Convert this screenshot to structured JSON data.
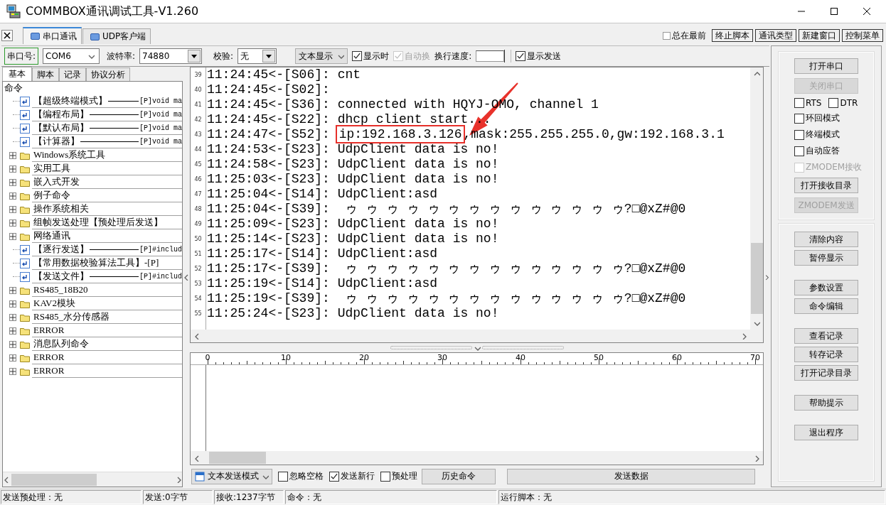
{
  "window": {
    "title": "COMMBOX通讯调试工具-V1.260"
  },
  "tabs": [
    {
      "label": "串口通讯",
      "selected": true
    },
    {
      "label": "UDP客户端",
      "selected": false
    }
  ],
  "always_on_top": {
    "label": "总在最前",
    "checked": false
  },
  "top_buttons": [
    "终止脚本",
    "通讯类型",
    "新建窗口",
    "控制菜单"
  ],
  "serial_bar": {
    "port_label": "串口号:",
    "port": "COM6",
    "baud_label": "波特率:",
    "baud": "74880",
    "parity_label": "校验:",
    "parity": "无",
    "display_mode": "文本显示",
    "checkboxes": [
      {
        "label": "显示时",
        "checked": true,
        "disabled": false
      },
      {
        "label": "自动换",
        "checked": true,
        "disabled": true
      }
    ],
    "line_speed_label": "换行速度:",
    "show_send": {
      "label": "显示发送",
      "checked": true,
      "disabled": false
    }
  },
  "left_tabs": [
    {
      "label": "基本",
      "selected": true
    },
    {
      "label": "脚本",
      "selected": false
    },
    {
      "label": "记录",
      "selected": false
    },
    {
      "label": "协议分析",
      "selected": false
    }
  ],
  "tree": [
    {
      "kind": "root",
      "label": "命令",
      "children": [
        {
          "kind": "command",
          "label": "【超级终端模式】",
          "detail": "[P]void ma"
        },
        {
          "kind": "command",
          "label": "【编程布局】",
          "detail": "[P]void ma"
        },
        {
          "kind": "command",
          "label": "【默认布局】",
          "detail": "[P]void ma"
        },
        {
          "kind": "command",
          "label": "【计算器】",
          "detail": "[P]void ma"
        },
        {
          "kind": "folder",
          "label": "Windows系统工具"
        },
        {
          "kind": "folder",
          "label": "实用工具"
        },
        {
          "kind": "folder",
          "label": "嵌入式开发"
        },
        {
          "kind": "folder",
          "label": "例子命令"
        },
        {
          "kind": "folder",
          "label": "操作系统相关"
        },
        {
          "kind": "folder",
          "label": "组帧发送处理【预处理后发送】"
        },
        {
          "kind": "folder",
          "label": "网络通讯",
          "children": [
            {
              "kind": "command",
              "label": "【逐行发送】",
              "detail": "[P]#includ"
            },
            {
              "kind": "command",
              "label": "【常用数据校验算法工具】-[P]"
            },
            {
              "kind": "command",
              "label": "【发送文件】",
              "detail": "[P]#includ"
            }
          ]
        },
        {
          "kind": "folder",
          "label": "RS485_18B20"
        },
        {
          "kind": "folder",
          "label": "KAV2模块"
        },
        {
          "kind": "folder",
          "label": "RS485_水分传感器"
        },
        {
          "kind": "folder",
          "label": "ERROR"
        },
        {
          "kind": "folder",
          "label": "消息队列命令"
        },
        {
          "kind": "folder",
          "label": "ERROR"
        },
        {
          "kind": "folder",
          "label": "ERROR"
        }
      ]
    }
  ],
  "log": {
    "lines": [
      {
        "no": "39",
        "text": "11:24:45<-[S06]: cnt"
      },
      {
        "no": "40",
        "text": "11:24:45<-[S02]:"
      },
      {
        "no": "41",
        "text": "11:24:45<-[S36]: connected with HQYJ-OMO, channel 1"
      },
      {
        "no": "42",
        "text": "11:24:45<-[S22]: dhcp client start..."
      },
      {
        "no": "43",
        "text": "11:24:47<-[S52]: ",
        "marked": "ip:192.168.3.126",
        "rest": ",mask:255.255.255.0,gw:192.168.3.1"
      },
      {
        "no": "44",
        "text": "11:24:53<-[S23]: UdpClient data is no!"
      },
      {
        "no": "45",
        "text": "11:24:58<-[S23]: UdpClient data is no!"
      },
      {
        "no": "46",
        "text": "11:25:03<-[S23]: UdpClient data is no!"
      },
      {
        "no": "47",
        "text": "11:25:04<-[S14]: UdpClient:asd"
      },
      {
        "no": "48",
        "text": "11:25:04<-[S39]:  ゥ ゥ ゥ ゥ ゥ ゥ ゥ ゥ ゥ ゥ ゥ ゥ ゥ ゥ?□@xZ#@0"
      },
      {
        "no": "49",
        "text": "11:25:09<-[S23]: UdpClient data is no!"
      },
      {
        "no": "50",
        "text": "11:25:14<-[S23]: UdpClient data is no!"
      },
      {
        "no": "51",
        "text": "11:25:17<-[S14]: UdpClient:asd"
      },
      {
        "no": "52",
        "text": "11:25:17<-[S39]:  ゥ ゥ ゥ ゥ ゥ ゥ ゥ ゥ ゥ ゥ ゥ ゥ ゥ ゥ?□@xZ#@0"
      },
      {
        "no": "53",
        "text": "11:25:19<-[S14]: UdpClient:asd"
      },
      {
        "no": "54",
        "text": "11:25:19<-[S39]:  ゥ ゥ ゥ ゥ ゥ ゥ ゥ ゥ ゥ ゥ ゥ ゥ ゥ ゥ?□@xZ#@0"
      },
      {
        "no": "55",
        "text": "11:25:24<-[S23]: UdpClient data is no!"
      }
    ]
  },
  "annotations": [
    {
      "kind": "arrow"
    }
  ],
  "ruler": {
    "labels": [
      "0",
      "10",
      "20",
      "30",
      "40",
      "50",
      "60",
      "70"
    ]
  },
  "send_bar": {
    "mode": "文本发送模式",
    "checkboxes": [
      {
        "label": "忽略空格",
        "checked": false
      },
      {
        "label": "发送新行",
        "checked": true
      },
      {
        "label": "预处理",
        "checked": false
      }
    ],
    "buttons": [
      "历史命令",
      "发送数据"
    ]
  },
  "side_panel": {
    "port_group": [
      {
        "kind": "button",
        "label": "打开串口",
        "disabled": false
      },
      {
        "kind": "button",
        "label": "关闭串口",
        "disabled": true
      },
      {
        "kind": "checkbox_row",
        "items": [
          {
            "label": "RTS",
            "checked": false,
            "disabled": false
          },
          {
            "label": "DTR",
            "checked": false,
            "disabled": false
          }
        ]
      },
      {
        "kind": "checkbox",
        "label": "环回模式",
        "checked": false,
        "disabled": false
      },
      {
        "kind": "checkbox",
        "label": "终端模式",
        "checked": false,
        "disabled": false
      },
      {
        "kind": "checkbox",
        "label": "自动应答",
        "checked": false,
        "disabled": false
      },
      {
        "kind": "checkbox",
        "label": "ZMODEM接收",
        "checked": false,
        "disabled": true
      },
      {
        "kind": "button",
        "label": "打开接收目录",
        "disabled": false
      },
      {
        "kind": "button",
        "label": "ZMODEM发送",
        "disabled": true
      }
    ],
    "action_groups": [
      [
        "清除内容",
        "暂停显示"
      ],
      [
        "参数设置",
        "命令编辑"
      ],
      [
        "查看记录",
        "转存记录",
        "打开记录目录"
      ],
      [
        "帮助提示"
      ],
      [
        "退出程序"
      ]
    ]
  },
  "status_bar": [
    "发送预处理：无",
    "发送:0字节",
    "接收:1237字节",
    "命令：无",
    "运行脚本：无"
  ]
}
